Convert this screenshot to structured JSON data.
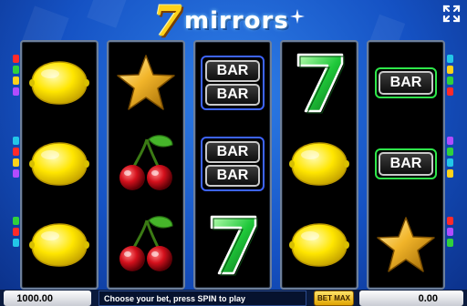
{
  "logo": {
    "seven": "7",
    "word": "mirrors"
  },
  "reels": [
    [
      "lemon",
      "lemon",
      "lemon"
    ],
    [
      "star",
      "cherries",
      "cherries"
    ],
    [
      "bar-bar",
      "bar-bar",
      "seven"
    ],
    [
      "seven",
      "lemon",
      "lemon"
    ],
    [
      "bar",
      "bar",
      "star"
    ]
  ],
  "symbols": {
    "bar_label": "BAR"
  },
  "bottom": {
    "balance": "1000.00",
    "message": "Choose your bet, press SPIN to play",
    "bet_max_label": "BET MAX",
    "win": "0.00"
  },
  "colors": {
    "background": "#1552c4",
    "reel_background": "#000000",
    "bar_frame_blue": "#3d64ff",
    "bar_frame_green": "#2ee84a",
    "seven": "#1fc83a",
    "lemon": "#ffe600",
    "star": "#f2b52a",
    "cherry": "#d4101c",
    "logo_seven": "#ffd21a"
  },
  "line_markers": [
    "#ff2a2a",
    "#2fd13c",
    "#ffd21a",
    "#b04cff",
    "#22c7e8"
  ],
  "icons": {
    "fullscreen": "fullscreen-icon"
  }
}
